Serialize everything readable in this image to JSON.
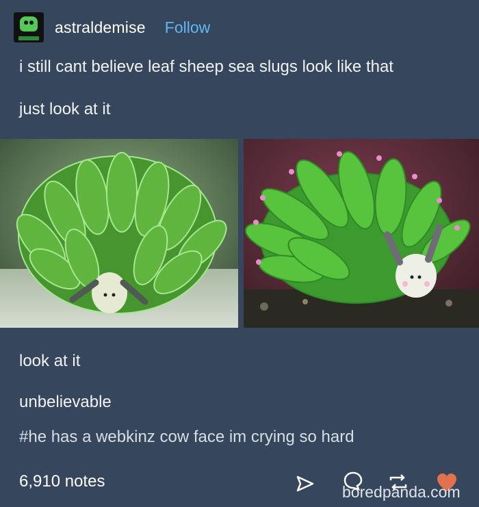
{
  "post": {
    "username": "astraldemise",
    "follow_label": "Follow",
    "body_lines": [
      "i still cant believe leaf sheep sea slugs look like that",
      "just look at it"
    ],
    "after_lines": [
      "look at it",
      "unbelievable"
    ],
    "tags": "#he has a webkinz cow face im crying so hard",
    "notes": "6,910 notes",
    "watermark": "boredpanda.com"
  },
  "icons": [
    "avatar-icon",
    "share-icon",
    "reply-icon",
    "reblog-icon",
    "like-icon"
  ],
  "colors": {
    "background": "#36465d",
    "follow": "#5fb8f4",
    "like": "#e2724f"
  }
}
